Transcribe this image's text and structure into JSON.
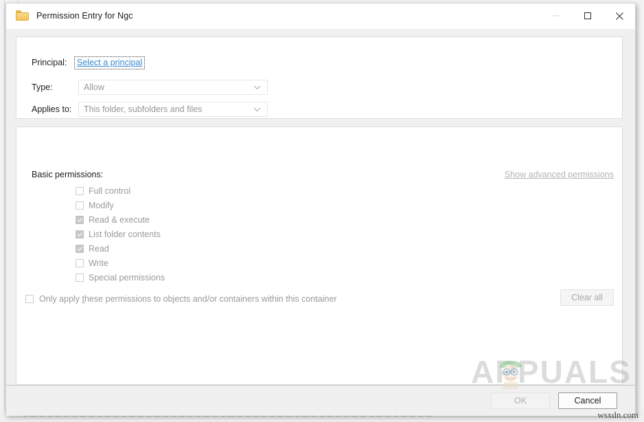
{
  "window": {
    "title": "Permission Entry for Ngc",
    "icon": "folder-icon",
    "controls": {
      "minimize": "—",
      "maximize": "□",
      "close": "✕"
    }
  },
  "top_panel": {
    "principal": {
      "label": "Principal:",
      "link_text": "Select a principal"
    },
    "type": {
      "label": "Type:",
      "value": "Allow"
    },
    "applies_to": {
      "label": "Applies to:",
      "value": "This folder, subfolders and files"
    }
  },
  "permissions_panel": {
    "basic_label": "Basic permissions:",
    "advanced_link": "Show advanced permissions",
    "items": [
      {
        "label": "Full control",
        "checked": false
      },
      {
        "label": "Modify",
        "checked": false
      },
      {
        "label": "Read & execute",
        "checked": true
      },
      {
        "label": "List folder contents",
        "checked": true
      },
      {
        "label": "Read",
        "checked": true
      },
      {
        "label": "Write",
        "checked": false
      },
      {
        "label": "Special permissions",
        "checked": false
      }
    ],
    "only_apply": {
      "label_pre": "Only apply ",
      "accel": "t",
      "label_post": "hese permissions to objects and/or containers within this container",
      "checked": false
    },
    "clear_all_label": "Clear all"
  },
  "buttons": {
    "ok": "OK",
    "cancel": "Cancel"
  },
  "watermarks": {
    "brand": "APPUALS",
    "site": "wsxdn.com"
  },
  "colors": {
    "link": "#3a8ad0",
    "disabled_text": "#9a9a9a",
    "panel_bg": "#ffffff",
    "dialog_bg": "#f0f0f0",
    "folder": "#f5c25b"
  }
}
